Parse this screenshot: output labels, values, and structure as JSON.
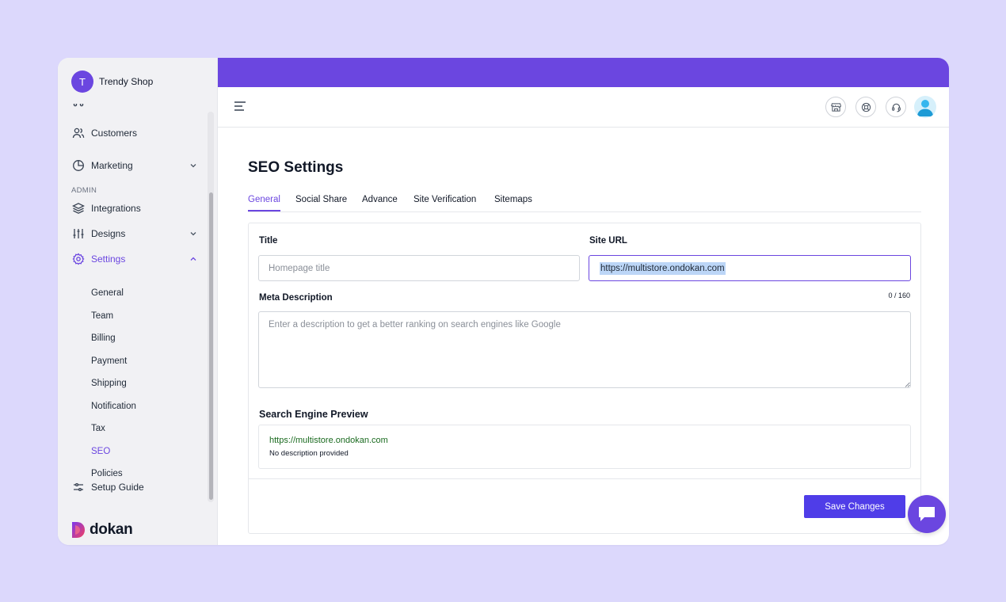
{
  "colors": {
    "accent": "#6b46e0",
    "button": "#4f3de8",
    "preview_url": "#1a6a1f",
    "background": "#dcd8fc"
  },
  "shop": {
    "initial": "T",
    "name": "Trendy Shop"
  },
  "sidebar": {
    "items": [
      {
        "label": "Customers",
        "icon": "users-icon"
      },
      {
        "label": "Marketing",
        "icon": "pie-chart-icon"
      }
    ],
    "admin_label": "ADMIN",
    "admin_items": [
      {
        "label": "Integrations",
        "icon": "layers-icon"
      },
      {
        "label": "Designs",
        "icon": "sliders-icon"
      },
      {
        "label": "Settings",
        "icon": "gear-icon"
      }
    ],
    "settings_sub": [
      "General",
      "Team",
      "Billing",
      "Payment",
      "Shipping",
      "Notification",
      "Tax",
      "SEO",
      "Policies"
    ],
    "setup_guide": "Setup Guide",
    "brand": "dokan"
  },
  "page": {
    "title": "SEO Settings",
    "tabs": [
      "General",
      "Social Share",
      "Advance",
      "Site Verification",
      "Sitemaps"
    ],
    "active_tab": "General"
  },
  "form": {
    "title_label": "Title",
    "title_placeholder": "Homepage title",
    "site_url_label": "Site URL",
    "site_url_value": "https://multistore.ondokan.com",
    "meta_label": "Meta Description",
    "meta_counter": "0 / 160",
    "meta_placeholder": "Enter a description to get a better ranking on search engines like Google",
    "preview_label": "Search Engine Preview",
    "preview_url": "https://multistore.ondokan.com",
    "preview_desc": "No description provided",
    "save_label": "Save Changes"
  }
}
